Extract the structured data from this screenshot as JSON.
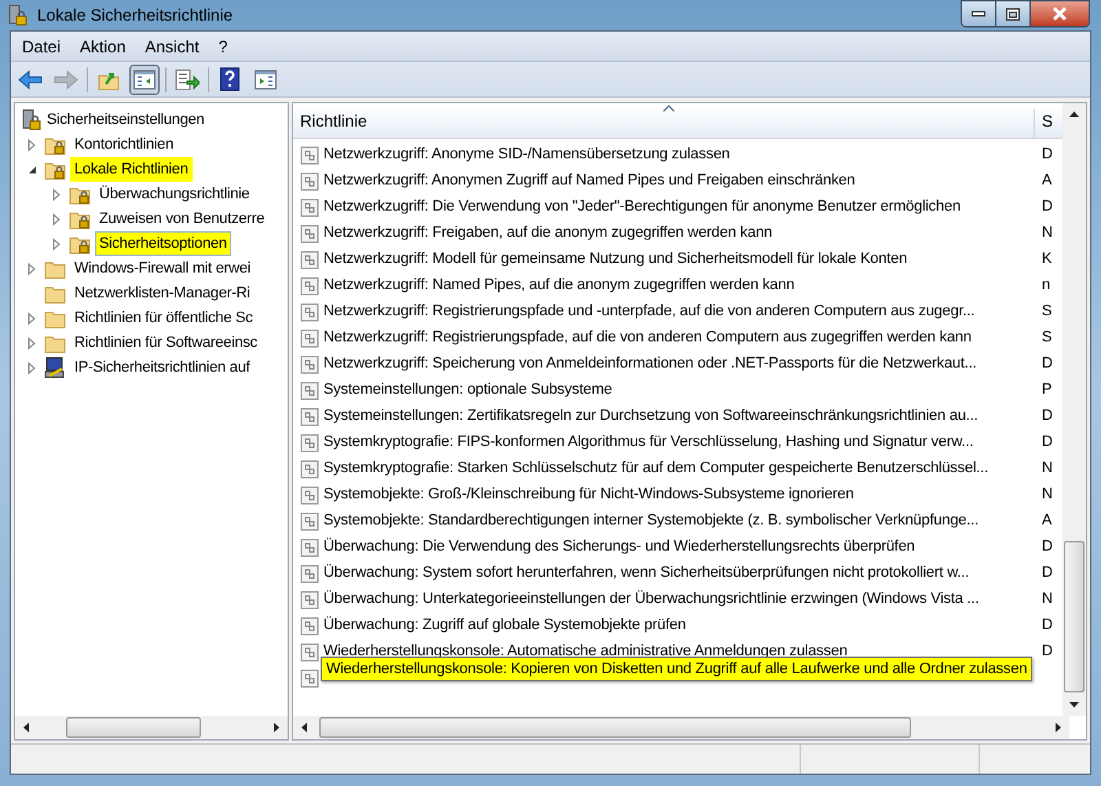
{
  "window": {
    "title": "Lokale Sicherheitsrichtlinie"
  },
  "menu": [
    "Datei",
    "Aktion",
    "Ansicht",
    "?"
  ],
  "toolbar": [
    {
      "kind": "back",
      "disabled": false,
      "pressed": false
    },
    {
      "kind": "forward",
      "disabled": true,
      "pressed": false
    },
    {
      "kind": "separator"
    },
    {
      "kind": "up",
      "disabled": false,
      "pressed": false
    },
    {
      "kind": "tree",
      "disabled": false,
      "pressed": true
    },
    {
      "kind": "separator"
    },
    {
      "kind": "export",
      "disabled": false,
      "pressed": false
    },
    {
      "kind": "separator"
    },
    {
      "kind": "help",
      "disabled": false,
      "pressed": false
    },
    {
      "kind": "actionpane",
      "disabled": false,
      "pressed": false
    }
  ],
  "tree": {
    "label": "Sicherheitseinstellungen",
    "children": [
      {
        "label": "Kontorichtlinien",
        "kind": "lockfolder",
        "expandable": true,
        "expanded": false,
        "selected": false,
        "highlighted": false
      },
      {
        "label": "Lokale Richtlinien",
        "kind": "lockfolder",
        "expandable": true,
        "expanded": true,
        "selected": false,
        "highlighted": true,
        "children": [
          {
            "label": "Überwachungsrichtlinie",
            "kind": "lockfolder",
            "expandable": true,
            "expanded": false,
            "selected": false,
            "highlighted": false
          },
          {
            "label": "Zuweisen von Benutzerre",
            "kind": "lockfolder",
            "expandable": true,
            "expanded": false,
            "selected": false,
            "highlighted": false
          },
          {
            "label": "Sicherheitsoptionen",
            "kind": "lockfolder",
            "expandable": true,
            "expanded": false,
            "selected": true,
            "highlighted": true
          }
        ]
      },
      {
        "label": "Windows-Firewall mit erwei",
        "kind": "folder",
        "expandable": true,
        "expanded": false,
        "selected": false,
        "highlighted": false
      },
      {
        "label": "Netzwerklisten-Manager-Ri",
        "kind": "folder",
        "expandable": false,
        "selected": false,
        "highlighted": false
      },
      {
        "label": "Richtlinien für öffentliche Sc",
        "kind": "folder",
        "expandable": true,
        "expanded": false,
        "selected": false,
        "highlighted": false
      },
      {
        "label": "Richtlinien für Softwareeinsc",
        "kind": "folder",
        "expandable": true,
        "expanded": false,
        "selected": false,
        "highlighted": false
      },
      {
        "label": "IP-Sicherheitsrichtlinien auf",
        "kind": "computer",
        "expandable": true,
        "expanded": false,
        "selected": false,
        "highlighted": false
      }
    ]
  },
  "table": {
    "columns": [
      {
        "label": "Richtlinie",
        "sorted": true
      },
      {
        "label": "S",
        "sorted": false
      }
    ],
    "rows": [
      {
        "policy": "Netzwerkzugriff: Anonyme SID-/Namensübersetzung zulassen",
        "column_2": "D"
      },
      {
        "policy": "Netzwerkzugriff: Anonymen Zugriff auf Named Pipes und Freigaben einschränken",
        "column_2": "A"
      },
      {
        "policy": "Netzwerkzugriff: Die Verwendung von \"Jeder\"-Berechtigungen für anonyme Benutzer ermöglichen",
        "column_2": "D"
      },
      {
        "policy": "Netzwerkzugriff: Freigaben, auf die anonym zugegriffen werden kann",
        "column_2": "N"
      },
      {
        "policy": "Netzwerkzugriff: Modell für gemeinsame Nutzung und Sicherheitsmodell für lokale Konten",
        "column_2": "K"
      },
      {
        "policy": "Netzwerkzugriff: Named Pipes, auf die anonym zugegriffen werden kann",
        "column_2": "n"
      },
      {
        "policy": "Netzwerkzugriff: Registrierungspfade und -unterpfade, auf die von anderen Computern aus zugegr...",
        "column_2": "S"
      },
      {
        "policy": "Netzwerkzugriff: Registrierungspfade, auf die von anderen Computern aus zugegriffen werden kann",
        "column_2": "S"
      },
      {
        "policy": "Netzwerkzugriff: Speicherung von Anmeldeinformationen oder .NET-Passports für die Netzwerkaut...",
        "column_2": "D"
      },
      {
        "policy": "Systemeinstellungen: optionale Subsysteme",
        "column_2": "P"
      },
      {
        "policy": "Systemeinstellungen: Zertifikatsregeln zur Durchsetzung von Softwareeinschränkungsrichtlinien au...",
        "column_2": "D"
      },
      {
        "policy": "Systemkryptografie: FIPS-konformen Algorithmus für Verschlüsselung, Hashing und Signatur verw...",
        "column_2": "D"
      },
      {
        "policy": "Systemkryptografie: Starken Schlüsselschutz für auf dem Computer gespeicherte Benutzerschlüssel...",
        "column_2": "N"
      },
      {
        "policy": "Systemobjekte: Groß-/Kleinschreibung für Nicht-Windows-Subsysteme ignorieren",
        "column_2": "N"
      },
      {
        "policy": "Systemobjekte: Standardberechtigungen interner Systemobjekte (z. B. symbolischer Verknüpfunge...",
        "column_2": "A"
      },
      {
        "policy": "Überwachung: Die Verwendung des Sicherungs- und Wiederherstellungsrechts überprüfen",
        "column_2": "D"
      },
      {
        "policy": "Überwachung: System sofort herunterfahren, wenn Sicherheitsüberprüfungen nicht protokolliert w...",
        "column_2": "D"
      },
      {
        "policy": "Überwachung: Unterkategorieeinstellungen der Überwachungsrichtlinie erzwingen (Windows Vista ...",
        "column_2": "N"
      },
      {
        "policy": "Überwachung: Zugriff auf globale Systemobjekte prüfen",
        "column_2": "D"
      },
      {
        "policy": "Wiederherstellungskonsole: Automatische administrative Anmeldungen zulassen",
        "column_2": "D"
      }
    ],
    "tooltip": "Wiederherstellungskonsole: Kopieren von Disketten und Zugriff auf alle Laufwerke und alle Ordner zulassen"
  }
}
